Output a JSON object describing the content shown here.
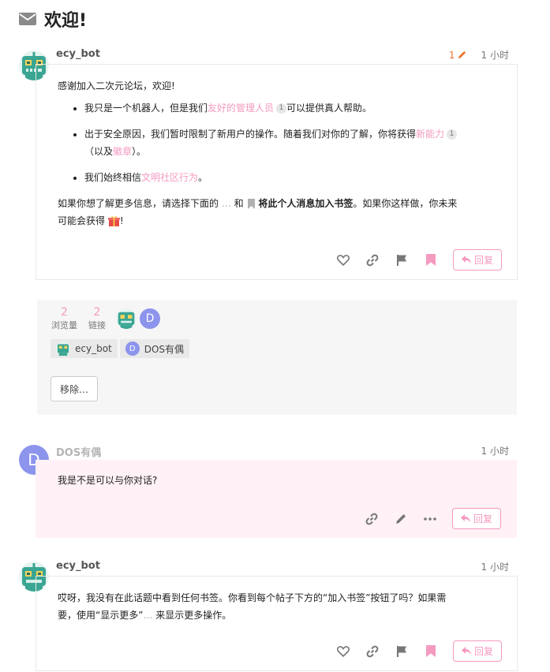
{
  "topic": {
    "title": "欢迎!"
  },
  "posts": [
    {
      "username": "ecy_bot",
      "edit_count": "1",
      "time": "1 小时",
      "intro": "感谢加入二次元论坛，欢迎!",
      "b1_pre": "我只是一个机器人，但是我们",
      "b1_link": "友好的管理人员",
      "b1_badge": "1",
      "b1_post": "可以提供真人帮助。",
      "b2_pre": "出于安全原因，我们暂时限制了新用户的操作。随着我们对你的了解，你将获得",
      "b2_link": "新能力",
      "b2_badge": "1",
      "b2_mid": "（以及",
      "b2_link2": "徽章",
      "b2_post": "）。",
      "b3_pre": "我们始终相信",
      "b3_link": "文明社区行为",
      "b3_post": "。",
      "p2_pre": "如果你想了解更多信息，请选择下面的",
      "p2_dots": "…",
      "p2_and": "和",
      "p2_bold": "将此个人消息加入书签",
      "p2_post": "。如果你这样做，你未来",
      "p2_line2": "可能会获得",
      "p2_end": "!",
      "reply_label": "回复"
    },
    {
      "username": "DOS有偶",
      "avatar_letter": "D",
      "time": "1 小时",
      "body": "我是不是可以与你对话?",
      "reply_label": "回复"
    },
    {
      "username": "ecy_bot",
      "time": "1 小时",
      "body_line1": "哎呀，我没有在此话题中看到任何书签。你看到每个帖子下方的“加入书签”按钮了吗？如果需",
      "body_line2_pre": "要，使用“显示更多”",
      "body_line2_dots": "…",
      "body_line2_post": " 来显示更多操作。",
      "reply_label": "回复"
    }
  ],
  "summary": {
    "views_count": "2",
    "views_label": "浏览量",
    "links_count": "2",
    "links_label": "链接",
    "participant_letter": "D",
    "chips": [
      {
        "name": "ecy_bot"
      },
      {
        "name": "DOS有偶",
        "letter": "D"
      }
    ],
    "remove_label": "移除…"
  },
  "colors": {
    "accent_pink": "#f49ac1",
    "edit_orange": "#e8702a",
    "avatar_purple": "#8c94ec"
  }
}
